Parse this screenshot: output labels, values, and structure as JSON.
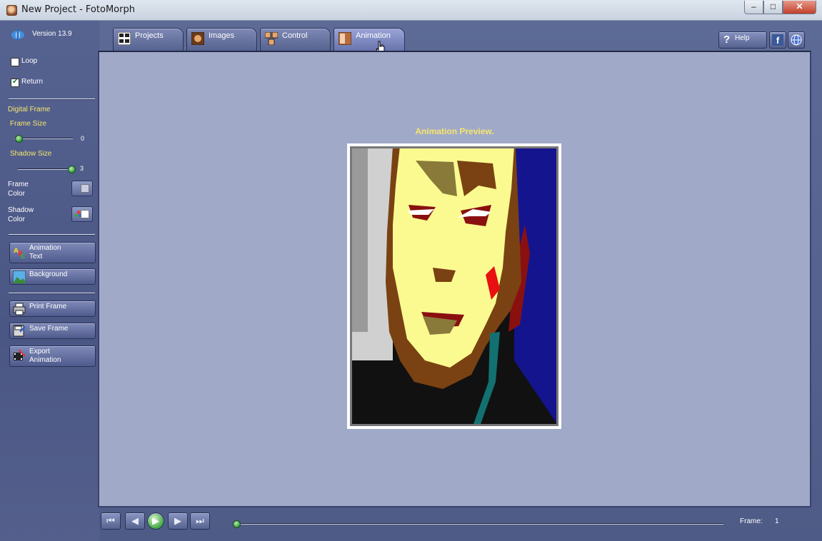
{
  "window": {
    "title": "New Project - FotoMorph"
  },
  "sidebar": {
    "version": "Version 13.9",
    "loop_label": "Loop",
    "loop_checked": false,
    "return_label": "Return",
    "return_checked": true,
    "digital_frame_label": "Digital Frame",
    "frame_size_label": "Frame Size",
    "frame_size_value": "0",
    "shadow_size_label": "Shadow Size",
    "shadow_size_value": "3",
    "frame_color_label_1": "Frame",
    "frame_color_label_2": "Color",
    "shadow_color_label_1": "Shadow",
    "shadow_color_label_2": "Color",
    "animation_text_label_1": "Animation",
    "animation_text_label_2": "Text",
    "background_label": "Background",
    "print_frame_label": "Print Frame",
    "save_frame_label": "Save Frame",
    "export_animation_label_1": "Export",
    "export_animation_label_2": "Animation"
  },
  "tabs": [
    {
      "label": "Projects",
      "icon": "projects-icon"
    },
    {
      "label": "Images",
      "icon": "images-icon"
    },
    {
      "label": "Control",
      "icon": "control-icon"
    },
    {
      "label": "Animation",
      "icon": "animation-icon",
      "active": true
    }
  ],
  "header": {
    "help_label": "Help"
  },
  "main": {
    "preview_title": "Animation Preview."
  },
  "playback": {
    "frame_label": "Frame:",
    "frame_value": "1",
    "position": 0
  },
  "colors": {
    "accent_yellow": "#f5e66a",
    "panel_bg": "#a1a9c8",
    "chrome_blue": "#4e5b86"
  }
}
